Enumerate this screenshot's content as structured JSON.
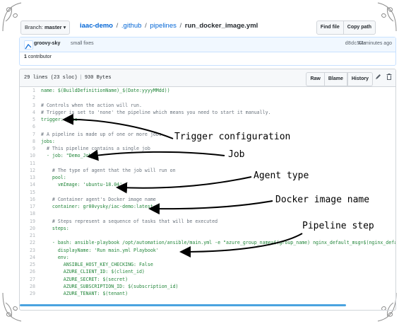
{
  "topbar": {
    "branch_label": "Branch:",
    "branch_name": "master",
    "branch_caret": "▾",
    "breadcrumb": {
      "repo": "iaac-demo",
      "sep": "/",
      "dir1": ".github",
      "dir2": "pipelines",
      "file": "run_docker_image.yml"
    },
    "find_file": "Find file",
    "copy_path": "Copy path"
  },
  "commit": {
    "author": "groovy-sky",
    "message": "small fixes",
    "sha": "d8dc52a",
    "time": "44 minutes ago",
    "contributors_count": "1",
    "contributors_label": "contributor"
  },
  "file": {
    "lines_info": "29 lines (23 sloc)",
    "size": "930 Bytes",
    "raw": "Raw",
    "blame": "Blame",
    "history": "History",
    "edit_icon": "pencil-icon",
    "delete_icon": "trash-icon"
  },
  "code_lines": [
    {
      "n": "1",
      "t": "name: $(BuildDefinitionName)_$(Date:yyyyMMdd))",
      "k": "key"
    },
    {
      "n": "2",
      "t": "",
      "k": "dark"
    },
    {
      "n": "3",
      "t": "# Controls when the action will run.",
      "k": "comment"
    },
    {
      "n": "4",
      "t": "# Trigger is set to 'none' the pipeline which means you need to start it manually.",
      "k": "comment"
    },
    {
      "n": "5",
      "t": "trigger: none",
      "k": "key"
    },
    {
      "n": "6",
      "t": "",
      "k": "dark"
    },
    {
      "n": "7",
      "t": "# A pipeline is made up of one or more jobs",
      "k": "comment"
    },
    {
      "n": "8",
      "t": "jobs:",
      "k": "key"
    },
    {
      "n": "9",
      "t": "  # This pipeline contains a single job",
      "k": "comment"
    },
    {
      "n": "10",
      "t": "  - job: \"Demo_Job\"",
      "k": "key"
    },
    {
      "n": "11",
      "t": "",
      "k": "dark"
    },
    {
      "n": "12",
      "t": "    # The type of agent that the job will run on",
      "k": "comment"
    },
    {
      "n": "13",
      "t": "    pool:",
      "k": "key"
    },
    {
      "n": "14",
      "t": "      vmImage: 'ubuntu-18.04'",
      "k": "key"
    },
    {
      "n": "15",
      "t": "",
      "k": "dark"
    },
    {
      "n": "16",
      "t": "    # Container agent's Docker image name",
      "k": "comment"
    },
    {
      "n": "17",
      "t": "    container: gr00vysky/iac-demo:latest",
      "k": "key"
    },
    {
      "n": "18",
      "t": "",
      "k": "dark"
    },
    {
      "n": "19",
      "t": "    # Steps represent a sequence of tasks that will be executed",
      "k": "comment"
    },
    {
      "n": "20",
      "t": "    steps:",
      "k": "key"
    },
    {
      "n": "21",
      "t": "",
      "k": "dark"
    },
    {
      "n": "22",
      "t": "    - bash: ansible-playbook /opt/automation/ansible/main.yml -e \"azure_group_name=$(group_name) nginx_default_msg=$(nginx_defau",
      "k": "key"
    },
    {
      "n": "23",
      "t": "      displayName: 'Run main.yml Playbook'",
      "k": "key"
    },
    {
      "n": "24",
      "t": "      env:",
      "k": "key"
    },
    {
      "n": "25",
      "t": "        ANSIBLE_HOST_KEY_CHECKING: False",
      "k": "key"
    },
    {
      "n": "26",
      "t": "        AZURE_CLIENT_ID: $(client_id)",
      "k": "key"
    },
    {
      "n": "27",
      "t": "        AZURE_SECRET: $(secret)",
      "k": "key"
    },
    {
      "n": "28",
      "t": "        AZURE_SUBSCRIPTION_ID: $(subscription_id)",
      "k": "key"
    },
    {
      "n": "29",
      "t": "        AZURE_TENANT: $(tenant)",
      "k": "key"
    }
  ],
  "annotations": {
    "trigger": "Trigger configuration",
    "job": "Job",
    "agent": "Agent type",
    "docker": "Docker image name",
    "pipeline": "Pipeline step"
  },
  "colors": {
    "link": "#0366d6",
    "comment": "#6a737d",
    "key": "#22863a",
    "scrollbar": "#4aa3df"
  }
}
